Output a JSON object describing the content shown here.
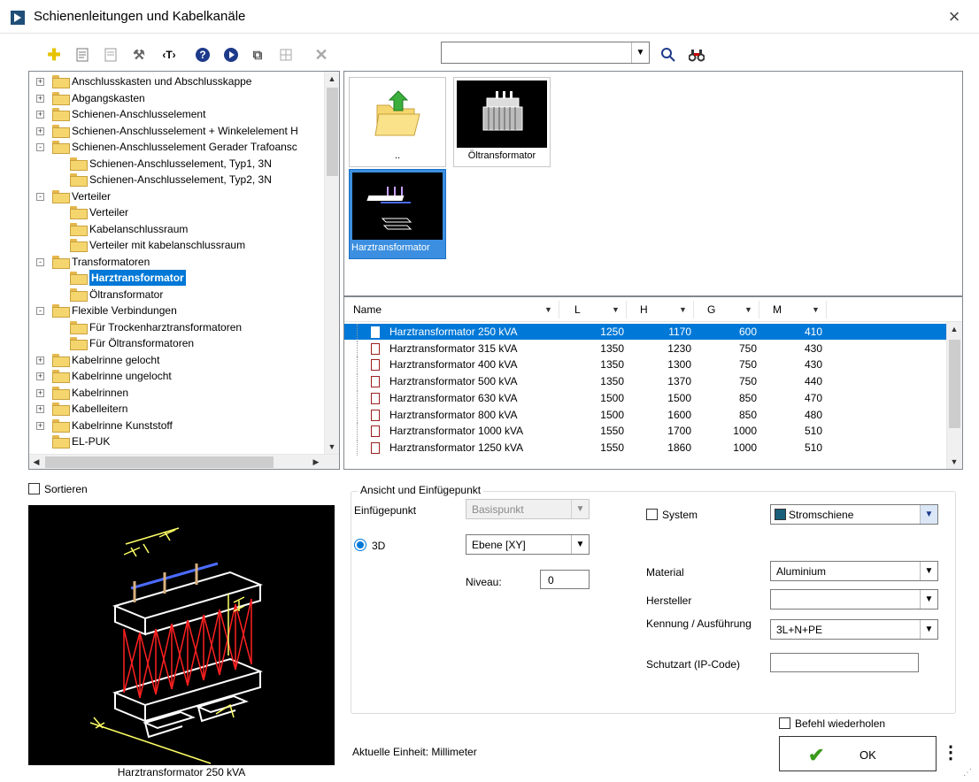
{
  "window": {
    "title": "Schienenleitungen und Kabelkanäle",
    "close_glyph": "×"
  },
  "toolbar": {
    "search_value": "",
    "search_placeholder": ""
  },
  "tree": {
    "items": [
      {
        "label": "Anschlusskasten und Abschlusskappe",
        "level": 0,
        "expander": "+"
      },
      {
        "label": "Abgangskasten",
        "level": 0,
        "expander": "+"
      },
      {
        "label": "Schienen-Anschlusselement",
        "level": 0,
        "expander": "+"
      },
      {
        "label": "Schienen-Anschlusselement + Winkelelement H",
        "level": 0,
        "expander": "+"
      },
      {
        "label": "Schienen-Anschlusselement Gerader Trafoansc",
        "level": 0,
        "expander": "-"
      },
      {
        "label": "Schienen-Anschlusselement, Typ1, 3N",
        "level": 1,
        "expander": ""
      },
      {
        "label": "Schienen-Anschlusselement, Typ2, 3N",
        "level": 1,
        "expander": ""
      },
      {
        "label": "Verteiler",
        "level": 0,
        "expander": "-"
      },
      {
        "label": "Verteiler",
        "level": 1,
        "expander": ""
      },
      {
        "label": "Kabelanschlussraum",
        "level": 1,
        "expander": ""
      },
      {
        "label": "Verteiler mit kabelanschlussraum",
        "level": 1,
        "expander": ""
      },
      {
        "label": "Transformatoren",
        "level": 0,
        "expander": "-"
      },
      {
        "label": "Harztransformator",
        "level": 1,
        "expander": "",
        "selected": true
      },
      {
        "label": "Öltransformator",
        "level": 1,
        "expander": ""
      },
      {
        "label": "Flexible Verbindungen",
        "level": 0,
        "expander": "-"
      },
      {
        "label": "Für Trockenharztransformatoren",
        "level": 1,
        "expander": ""
      },
      {
        "label": "Für Öltransformatoren",
        "level": 1,
        "expander": ""
      },
      {
        "label": "Kabelrinne gelocht",
        "level": 0,
        "expander": "+"
      },
      {
        "label": "Kabelrinne ungelocht",
        "level": 0,
        "expander": "+"
      },
      {
        "label": "Kabelrinnen",
        "level": 0,
        "expander": "+"
      },
      {
        "label": "Kabelleitern",
        "level": 0,
        "expander": "+"
      },
      {
        "label": "Kabelrinne Kunststoff",
        "level": 0,
        "expander": "+"
      },
      {
        "label": "EL-PUK",
        "level": 0,
        "expander": ""
      }
    ]
  },
  "gallery": {
    "tiles": [
      {
        "caption": ".."
      },
      {
        "caption": "Öltransformator"
      },
      {
        "caption": "Harztransformator",
        "selected": true
      }
    ]
  },
  "table": {
    "columns": [
      "Name",
      "L",
      "H",
      "G",
      "M"
    ],
    "rows": [
      {
        "name": "Harztransformator 250 kVA",
        "L": "1250",
        "H": "1170",
        "G": "600",
        "M": "410",
        "selected": true
      },
      {
        "name": "Harztransformator 315 kVA",
        "L": "1350",
        "H": "1230",
        "G": "750",
        "M": "430"
      },
      {
        "name": "Harztransformator 400 kVA",
        "L": "1350",
        "H": "1300",
        "G": "750",
        "M": "430"
      },
      {
        "name": "Harztransformator 500 kVA",
        "L": "1350",
        "H": "1370",
        "G": "750",
        "M": "440"
      },
      {
        "name": "Harztransformator 630 kVA",
        "L": "1500",
        "H": "1500",
        "G": "850",
        "M": "470"
      },
      {
        "name": "Harztransformator 800 kVA",
        "L": "1500",
        "H": "1600",
        "G": "850",
        "M": "480"
      },
      {
        "name": "Harztransformator 1000 kVA",
        "L": "1550",
        "H": "1700",
        "G": "1000",
        "M": "510"
      },
      {
        "name": "Harztransformator 1250 kVA",
        "L": "1550",
        "H": "1860",
        "G": "1000",
        "M": "510"
      }
    ]
  },
  "sort": {
    "label": "Sortieren",
    "checked": false
  },
  "preview": {
    "caption": "Harztransformator 250 kVA"
  },
  "insert": {
    "group_label": "Ansicht und Einfügepunkt",
    "einfuegepunkt_label": "Einfügepunkt",
    "einfuegepunkt_value": "Basispunkt",
    "radio_label": "3D",
    "ebene_value": "Ebene  [XY]",
    "niveau_label": "Niveau:",
    "niveau_value": "0",
    "system_label": "System",
    "system_value": "Stromschiene",
    "system_color": "#1a5f7a",
    "material_label": "Material",
    "material_value": "Aluminium",
    "hersteller_label": "Hersteller",
    "hersteller_value": "",
    "kennung_label": "Kennung / Ausführung",
    "kennung_value": "3L+N+PE",
    "schutzart_label": "Schutzart (IP-Code)",
    "schutzart_value": ""
  },
  "footer": {
    "repeat_label": "Befehl wiederholen",
    "unit_text": "Aktuelle Einheit: Millimeter",
    "ok_label": "OK",
    "more_glyph": "⋮"
  },
  "colors": {
    "selection": "#0078d7",
    "preview_lines": "#ff2020",
    "accent_blue": "#1f4e79"
  }
}
